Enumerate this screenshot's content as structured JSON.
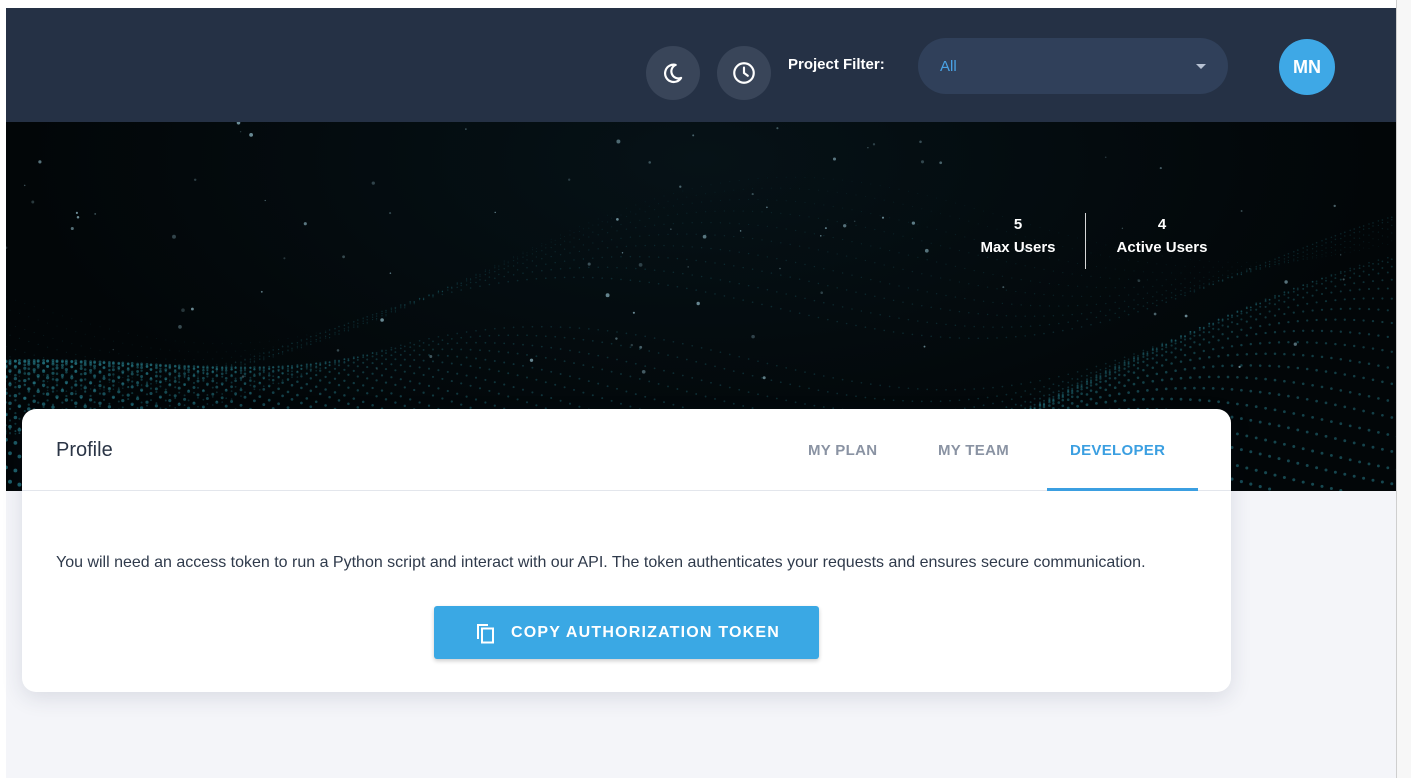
{
  "header": {
    "theme_icon": "moon-icon",
    "history_icon": "clock-icon",
    "project_filter_label": "Project Filter:",
    "project_filter_value": "All",
    "avatar_initials": "MN"
  },
  "stats": [
    {
      "value": "5",
      "label": "Max Users"
    },
    {
      "value": "4",
      "label": "Active Users"
    }
  ],
  "profile": {
    "title": "Profile",
    "tabs": [
      {
        "label": "MY PLAN",
        "active": false
      },
      {
        "label": "MY TEAM",
        "active": false
      },
      {
        "label": "DEVELOPER",
        "active": true
      }
    ],
    "description": "You will need an access token to run a Python script and interact with our API. The token authenticates your requests and ensures secure communication.",
    "copy_button_label": "COPY AUTHORIZATION TOKEN",
    "copy_icon": "copy-icon"
  },
  "colors": {
    "topbar": "#253145",
    "accent": "#3aa8e4",
    "avatar": "#3ea8e6",
    "card_bg": "#ffffff",
    "page_bg": "#f4f5f9"
  }
}
